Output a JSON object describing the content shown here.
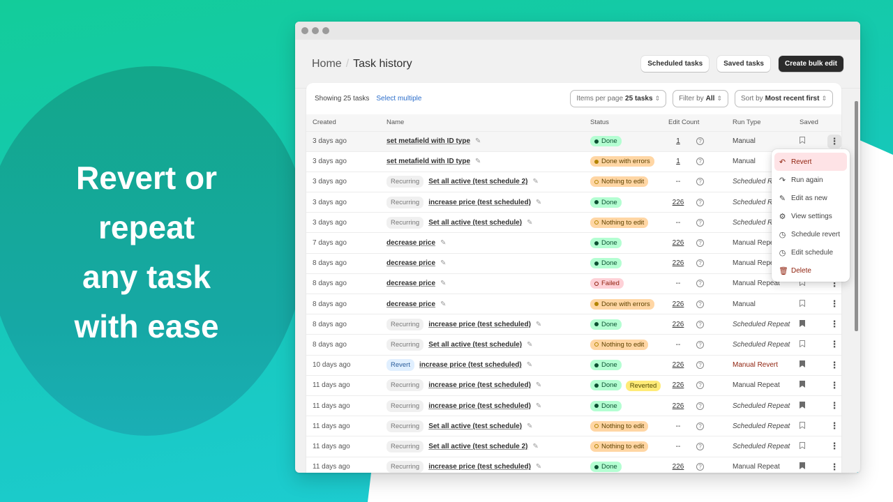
{
  "hero": {
    "lines": [
      "Revert or",
      "repeat",
      "any task",
      "with ease"
    ]
  },
  "colors": {
    "accent": "#2c6ecb",
    "done": "#b4fed2",
    "warning": "#ffd6a4",
    "failed": "#fed1d7",
    "reverted": "#ffeb78",
    "danger": "#8e1f0b"
  },
  "breadcrumb": {
    "home": "Home",
    "current": "Task history"
  },
  "header_buttons": {
    "scheduled": "Scheduled tasks",
    "saved": "Saved tasks",
    "create": "Create bulk edit"
  },
  "toolbar": {
    "showing": "Showing 25 tasks",
    "select_multiple": "Select multiple",
    "items_per_page_label": "Items per page",
    "items_per_page_value": "25 tasks",
    "filter_label": "Filter by",
    "filter_value": "All",
    "sort_label": "Sort by",
    "sort_value": "Most recent first"
  },
  "columns": [
    "Created",
    "Name",
    "Status",
    "Edit Count",
    "Run Type",
    "Saved"
  ],
  "rows": [
    {
      "created": "3 days ago",
      "tag": "",
      "name": "set metafield with ID type",
      "status": "Done",
      "status_kind": "done",
      "extra": "",
      "count": "1",
      "run_type": "Manual",
      "run_style": "",
      "saved": false
    },
    {
      "created": "3 days ago",
      "tag": "",
      "name": "set metafield with ID type",
      "status": "Done with errors",
      "status_kind": "err",
      "extra": "",
      "count": "1",
      "run_type": "Manual",
      "run_style": "",
      "saved": false
    },
    {
      "created": "3 days ago",
      "tag": "Recurring",
      "name": "Set all active (test schedule 2)",
      "status": "Nothing to edit",
      "status_kind": "nothing",
      "extra": "",
      "count": "--",
      "run_type": "Scheduled Repeat",
      "run_style": "italic",
      "saved": false
    },
    {
      "created": "3 days ago",
      "tag": "Recurring",
      "name": "increase price (test scheduled)",
      "status": "Done",
      "status_kind": "done",
      "extra": "",
      "count": "226",
      "run_type": "Scheduled Repeat",
      "run_style": "italic",
      "saved": true
    },
    {
      "created": "3 days ago",
      "tag": "Recurring",
      "name": "Set all active (test schedule)",
      "status": "Nothing to edit",
      "status_kind": "nothing",
      "extra": "",
      "count": "--",
      "run_type": "Scheduled Repeat",
      "run_style": "italic",
      "saved": false
    },
    {
      "created": "7 days ago",
      "tag": "",
      "name": "decrease price",
      "status": "Done",
      "status_kind": "done",
      "extra": "",
      "count": "226",
      "run_type": "Manual Repeat",
      "run_style": "",
      "saved": true
    },
    {
      "created": "8 days ago",
      "tag": "",
      "name": "decrease price",
      "status": "Done",
      "status_kind": "done",
      "extra": "",
      "count": "226",
      "run_type": "Manual Repeat",
      "run_style": "",
      "saved": true
    },
    {
      "created": "8 days ago",
      "tag": "",
      "name": "decrease price",
      "status": "Failed",
      "status_kind": "failed",
      "extra": "",
      "count": "--",
      "run_type": "Manual Repeat",
      "run_style": "",
      "saved": false
    },
    {
      "created": "8 days ago",
      "tag": "",
      "name": "decrease price",
      "status": "Done with errors",
      "status_kind": "err",
      "extra": "",
      "count": "226",
      "run_type": "Manual",
      "run_style": "",
      "saved": false
    },
    {
      "created": "8 days ago",
      "tag": "Recurring",
      "name": "increase price (test scheduled)",
      "status": "Done",
      "status_kind": "done",
      "extra": "",
      "count": "226",
      "run_type": "Scheduled Repeat",
      "run_style": "italic",
      "saved": true
    },
    {
      "created": "8 days ago",
      "tag": "Recurring",
      "name": "Set all active (test schedule)",
      "status": "Nothing to edit",
      "status_kind": "nothing",
      "extra": "",
      "count": "--",
      "run_type": "Scheduled Repeat",
      "run_style": "italic",
      "saved": false
    },
    {
      "created": "10 days ago",
      "tag": "Revert",
      "name": "increase price (test scheduled)",
      "status": "Done",
      "status_kind": "done",
      "extra": "",
      "count": "226",
      "run_type": "Manual Revert",
      "run_style": "red",
      "saved": true
    },
    {
      "created": "11 days ago",
      "tag": "Recurring",
      "name": "increase price (test scheduled)",
      "status": "Done",
      "status_kind": "done",
      "extra": "Reverted",
      "count": "226",
      "run_type": "Manual Repeat",
      "run_style": "",
      "saved": true
    },
    {
      "created": "11 days ago",
      "tag": "Recurring",
      "name": "increase price (test scheduled)",
      "status": "Done",
      "status_kind": "done",
      "extra": "",
      "count": "226",
      "run_type": "Scheduled Repeat",
      "run_style": "italic",
      "saved": true
    },
    {
      "created": "11 days ago",
      "tag": "Recurring",
      "name": "Set all active (test schedule)",
      "status": "Nothing to edit",
      "status_kind": "nothing",
      "extra": "",
      "count": "--",
      "run_type": "Scheduled Repeat",
      "run_style": "italic",
      "saved": false
    },
    {
      "created": "11 days ago",
      "tag": "Recurring",
      "name": "Set all active (test schedule 2)",
      "status": "Nothing to edit",
      "status_kind": "nothing",
      "extra": "",
      "count": "--",
      "run_type": "Scheduled Repeat",
      "run_style": "italic",
      "saved": false
    },
    {
      "created": "11 days ago",
      "tag": "Recurring",
      "name": "increase price (test scheduled)",
      "status": "Done",
      "status_kind": "done",
      "extra": "",
      "count": "226",
      "run_type": "Manual Repeat",
      "run_style": "",
      "saved": true
    }
  ],
  "row_menu": {
    "items": [
      {
        "label": "Revert",
        "icon": "undo-icon",
        "glyph": "↶",
        "kind": "revert"
      },
      {
        "label": "Run again",
        "icon": "redo-icon",
        "glyph": "↷",
        "kind": ""
      },
      {
        "label": "Edit as new",
        "icon": "pencil-icon",
        "glyph": "✎",
        "kind": ""
      },
      {
        "label": "View settings",
        "icon": "gear-icon",
        "glyph": "⚙",
        "kind": ""
      },
      {
        "label": "Schedule revert",
        "icon": "calendar-clock-icon",
        "glyph": "◷",
        "kind": ""
      },
      {
        "label": "Edit schedule",
        "icon": "calendar-clock-icon",
        "glyph": "◷",
        "kind": ""
      },
      {
        "label": "Delete",
        "icon": "trash-icon",
        "glyph": "🗑",
        "kind": "delete"
      }
    ]
  }
}
